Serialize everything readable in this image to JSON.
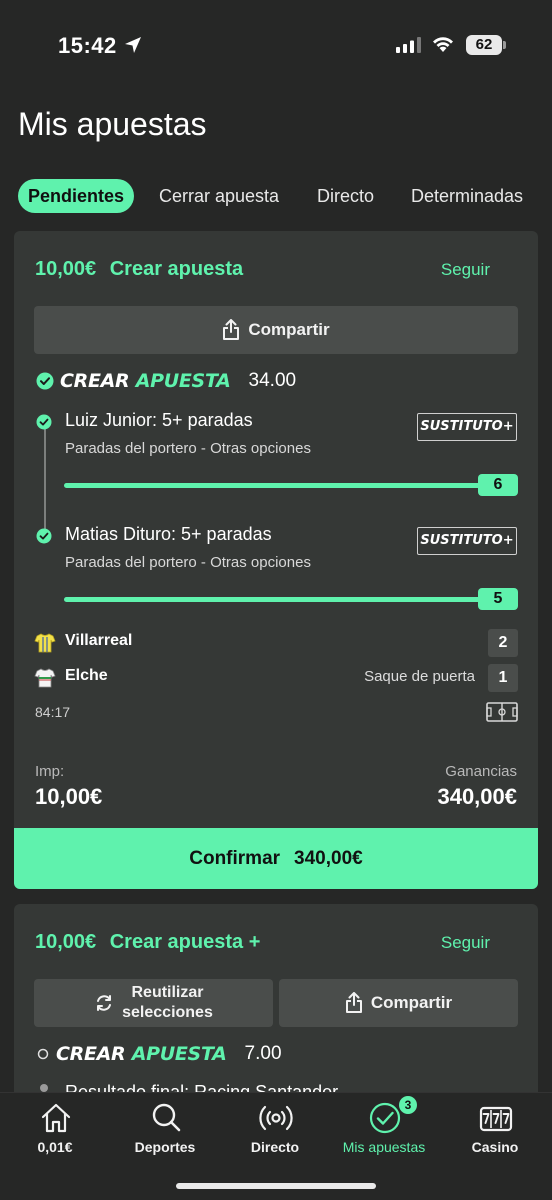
{
  "status_bar": {
    "time": "15:42",
    "battery": "62"
  },
  "page": {
    "title": "Mis apuestas"
  },
  "tabs": [
    "Pendientes",
    "Cerrar apuesta",
    "Directo",
    "Determinadas"
  ],
  "bet1": {
    "stake_display": "10,00€",
    "type_label": "Crear apuesta",
    "follow_label": "Seguir",
    "share_label": "Compartir",
    "brand_word1": "CREAR",
    "brand_word2": "APUESTA",
    "odds": "34.00",
    "selections": [
      {
        "title": "Luiz Junior: 5+ paradas",
        "subtitle": "Paradas del portero - Otras opciones",
        "badge": "SUSTITUTO+",
        "progress_value": "6"
      },
      {
        "title": "Matias Dituro: 5+ paradas",
        "subtitle": "Paradas del portero - Otras opciones",
        "badge": "SUSTITUTO+",
        "progress_value": "5"
      }
    ],
    "teams": [
      {
        "name": "Villarreal",
        "event": "",
        "score": "2"
      },
      {
        "name": "Elche",
        "event": "Saque de puerta",
        "score": "1"
      }
    ],
    "match_time": "84:17",
    "stake_label": "Imp:",
    "stake_value": "10,00€",
    "winnings_label": "Ganancias",
    "winnings_value": "340,00€",
    "confirm_label": "Confirmar",
    "confirm_amount": "340,00€"
  },
  "bet2": {
    "stake_display": "10,00€",
    "type_label": "Crear apuesta +",
    "follow_label": "Seguir",
    "reuse_label_line1": "Reutilizar",
    "reuse_label_line2": "selecciones",
    "share_label": "Compartir",
    "brand_word1": "CREAR",
    "brand_word2": "APUESTA",
    "odds": "7.00",
    "partial_selection": "Resultado final: Racing Santander"
  },
  "nav": {
    "items": [
      {
        "label": "0,01€",
        "icon": "home-icon"
      },
      {
        "label": "Deportes",
        "icon": "search-icon"
      },
      {
        "label": "Directo",
        "icon": "live-broadcast-icon"
      },
      {
        "label": "Mis apuestas",
        "icon": "check-circle-icon",
        "badge": "3"
      },
      {
        "label": "Casino",
        "icon": "slot-machine-icon"
      }
    ],
    "active_color": "#5ff2ad"
  },
  "colors": {
    "accent": "#5ff2ad",
    "background": "#262726",
    "card": "#353836"
  }
}
